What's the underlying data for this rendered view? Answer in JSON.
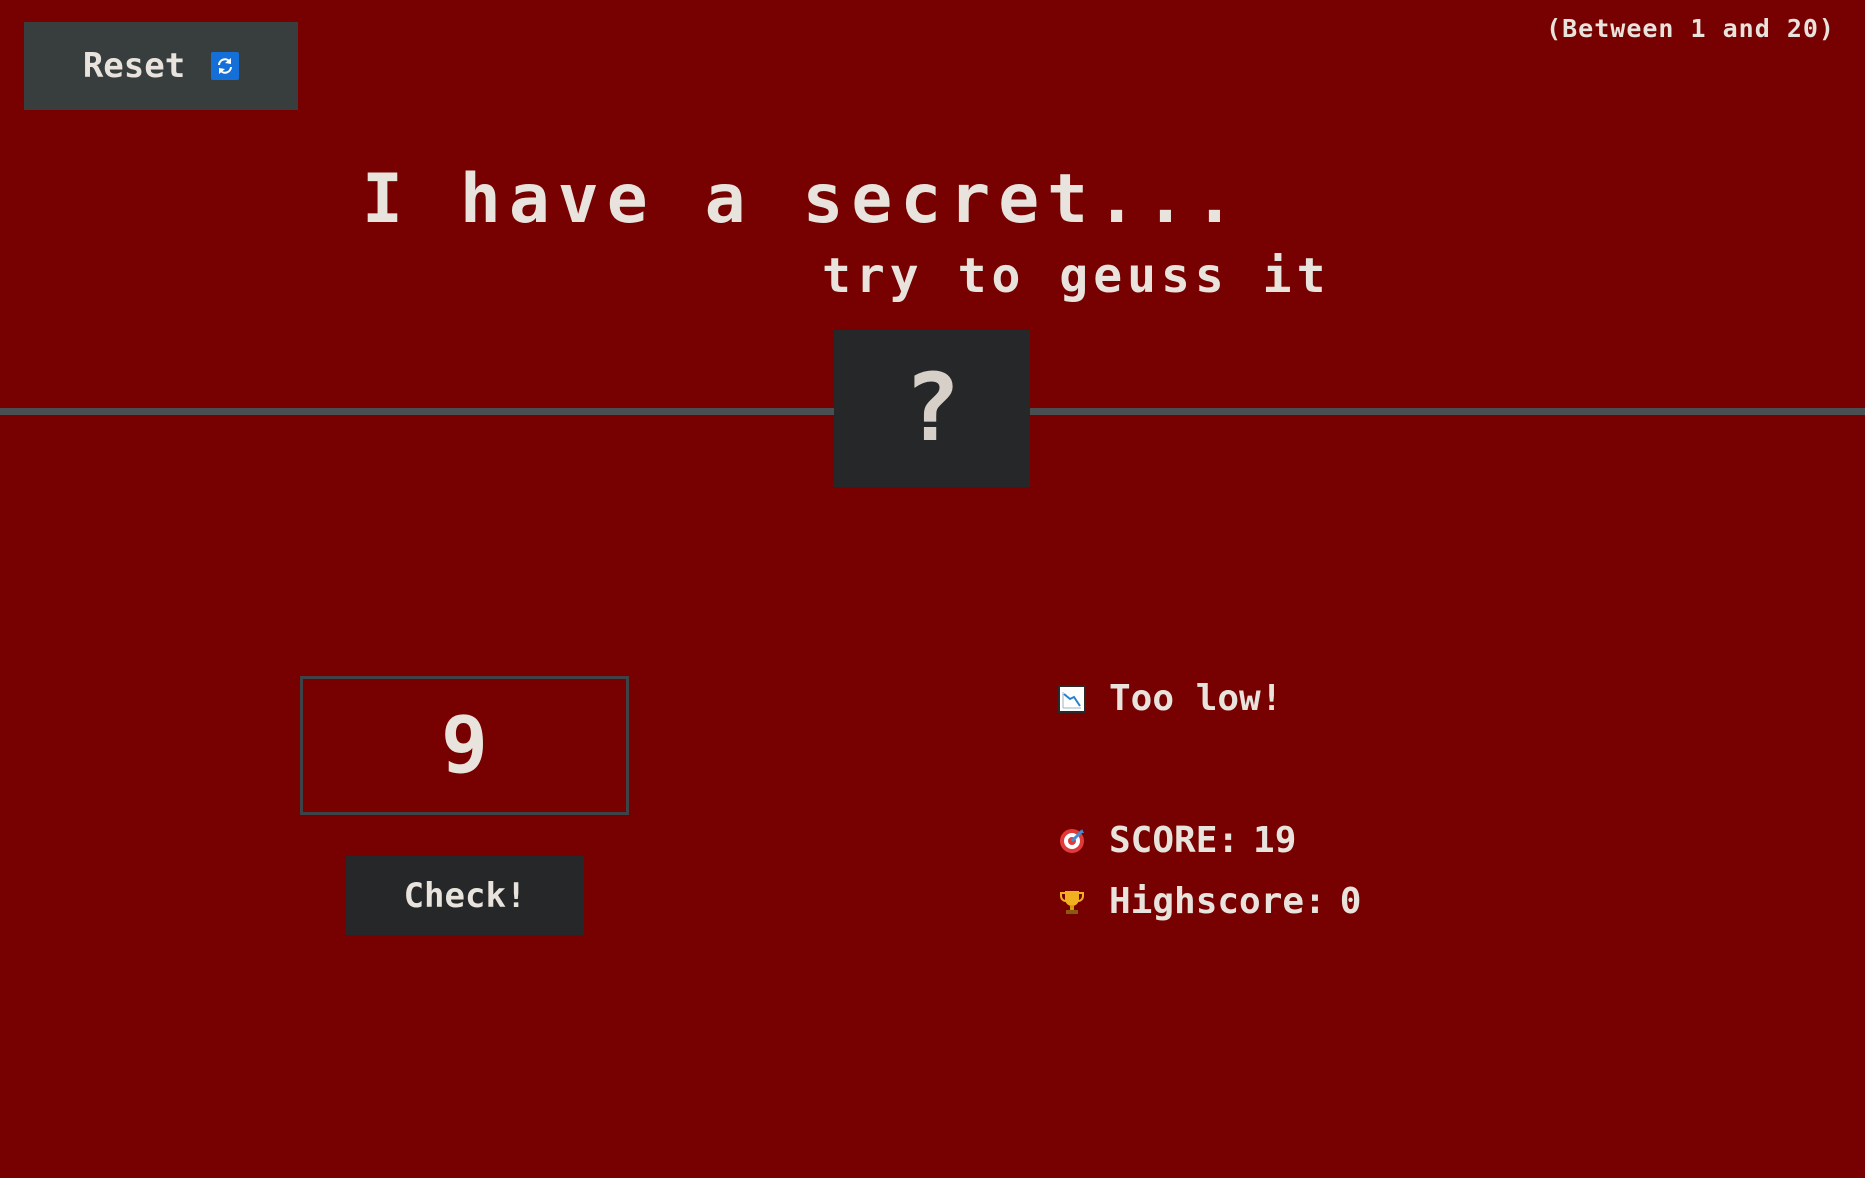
{
  "header": {
    "reset_label": "Reset",
    "reset_icon": "refresh-icon",
    "range_hint": "(Between 1 and 20)"
  },
  "main": {
    "title": "I have a secret...",
    "subtitle": "try to geuss it",
    "secret_display": "?"
  },
  "guess": {
    "value": "9",
    "check_label": "Check!"
  },
  "status": {
    "message": "Too low!",
    "message_icon": "chart-decreasing-icon",
    "score_label": "SCORE:",
    "score_value": "19",
    "score_icon": "target-icon",
    "highscore_label": "Highscore:",
    "highscore_value": "0",
    "highscore_icon": "trophy-icon"
  },
  "colors": {
    "background": "#770000",
    "panel": "#252728",
    "reset_button": "#383d3e",
    "text": "#e8e3dc",
    "accent_blue": "#1470d8"
  }
}
